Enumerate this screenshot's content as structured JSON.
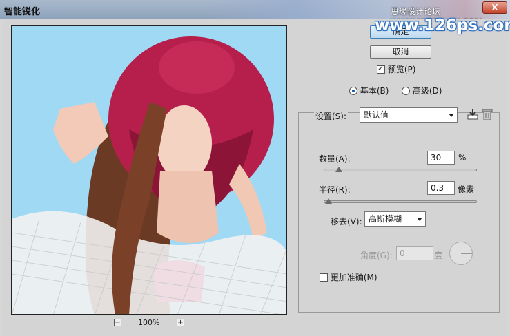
{
  "window": {
    "title": "智能锐化",
    "close_label": "X",
    "watermark_top": "思缘设计论坛 WWW.MISSYUAN.COM",
    "watermark_main": "www.126ps.com"
  },
  "buttons": {
    "ok_label": "确定",
    "cancel_label": "取消"
  },
  "preview_option": {
    "label": "预览(P)",
    "checked": true
  },
  "mode": {
    "basic_label": "基本(B)",
    "advanced_label": "高级(D)",
    "selected": "basic"
  },
  "settings": {
    "label": "设置(S):",
    "value": "默认值",
    "save_icon": "save-settings-icon",
    "delete_icon": "trash-icon"
  },
  "amount": {
    "label": "数量(A):",
    "value": "30",
    "unit": "%",
    "slider_fraction": 0.1
  },
  "radius": {
    "label": "半径(R):",
    "value": "0.3",
    "unit": "像素",
    "slider_fraction": 0.03
  },
  "remove": {
    "label": "移去(V):",
    "value": "高斯模糊"
  },
  "angle": {
    "label": "角度(G):",
    "value": "0",
    "unit": "度"
  },
  "more_accurate": {
    "label": "更加准确(M)",
    "checked": false
  },
  "zoom": {
    "value": "100%",
    "minus": "−",
    "plus": "+"
  }
}
